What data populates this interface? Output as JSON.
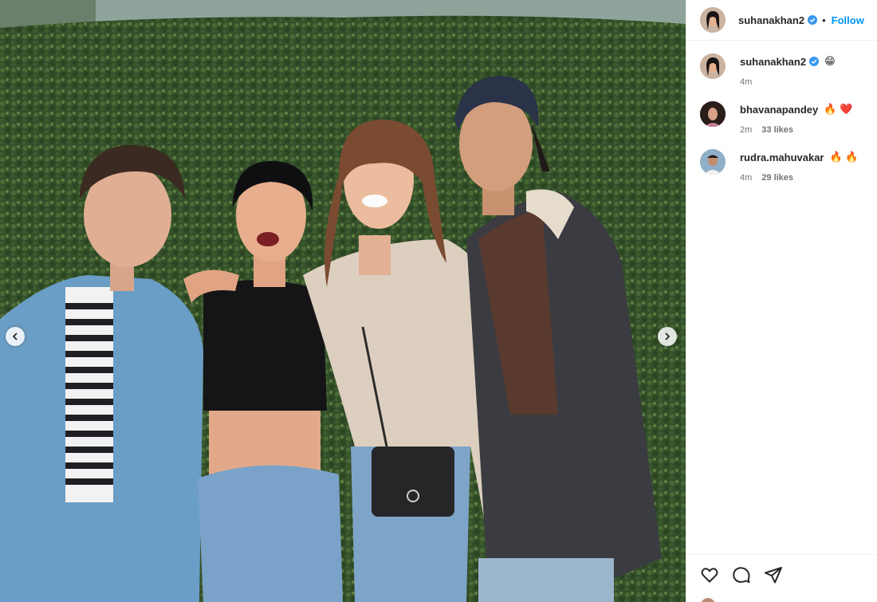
{
  "post": {
    "author": "suhanakhan2",
    "verified": true,
    "follow_label": "Follow",
    "separator": "•",
    "caption": {
      "user": "suhanakhan2",
      "text": "😁",
      "time": "4m"
    }
  },
  "comments": [
    {
      "user": "bhavanapandey",
      "text": "🔥 ❤️",
      "time": "2m",
      "likes": "33 likes"
    },
    {
      "user": "rudra.mahuvakar",
      "text": "🔥 🔥",
      "time": "4m",
      "likes": "29 likes"
    }
  ],
  "photo": {
    "alt_icon_prev": "chevron-left-icon",
    "alt_icon_next": "chevron-right-icon"
  },
  "actions": {
    "like": "heart-icon",
    "comment": "comment-icon",
    "share": "share-icon"
  },
  "colors": {
    "follow": "#0095f6",
    "verified": "#3897f0",
    "hedge": "#365227",
    "text": "#262626",
    "muted": "#737373"
  }
}
